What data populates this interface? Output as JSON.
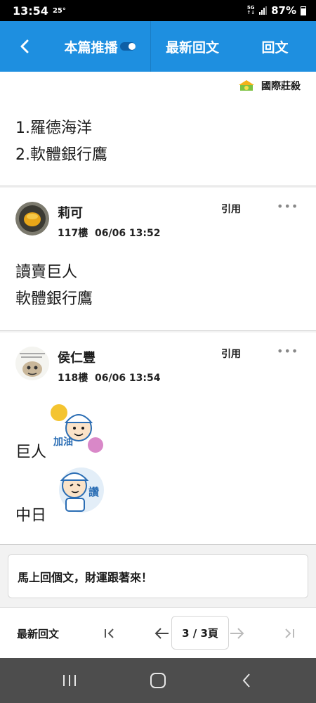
{
  "status_bar": {
    "time": "13:54",
    "temperature": "25°",
    "network_top": "5G",
    "network_bottom": "↑↓",
    "battery": "87%"
  },
  "header": {
    "back_icon": "chevron-left-icon",
    "tab_recommend": "本篇推播",
    "tab_latest": "最新回文",
    "tab_reply": "回文"
  },
  "article": {
    "board_name": "國際莊殺",
    "lines": [
      "1.羅德海洋",
      "2.軟體銀行鷹"
    ]
  },
  "posts": [
    {
      "author": "莉可",
      "floor": "117樓",
      "datetime": "06/06 13:52",
      "quote_label": "引用",
      "more": "•••",
      "lines": [
        "讀賣巨人",
        "軟體銀行鷹"
      ]
    },
    {
      "author": "侯仁豐",
      "floor": "118樓",
      "datetime": "06/06 13:54",
      "quote_label": "引用",
      "more": "•••",
      "lines": [
        "巨人",
        "中日"
      ],
      "sticker_text_1": "加油",
      "sticker_text_2": "讚"
    }
  ],
  "reply_prompt": "馬上回個文，財運跟著來！",
  "pager": {
    "latest_label": "最新回文",
    "page": "3 / 3頁"
  },
  "colors": {
    "accent": "#1e8fe0",
    "nav_bar": "#4d4d4d"
  }
}
